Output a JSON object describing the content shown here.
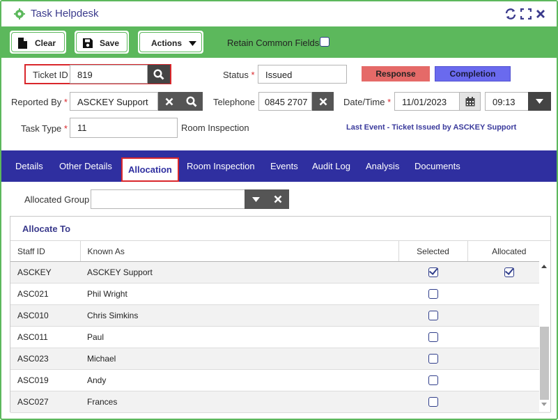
{
  "window": {
    "title": "Task Helpdesk",
    "icons": [
      "refresh-icon",
      "maximize-icon",
      "close-icon"
    ]
  },
  "toolbar": {
    "clear_label": "Clear",
    "save_label": "Save",
    "actions_label": "Actions",
    "retain_label": "Retain Common Fields",
    "retain_checked": false
  },
  "form": {
    "ticket_id_label": "Ticket ID",
    "ticket_id_value": "819",
    "status_label": "Status",
    "status_value": "Issued",
    "response_label": "Response",
    "completion_label": "Completion",
    "reported_by_label": "Reported By",
    "reported_by_value": "ASCKEY Support",
    "telephone_label": "Telephone",
    "telephone_value": "0845 2707",
    "datetime_label": "Date/Time",
    "date_value": "11/01/2023",
    "time_value": "09:13",
    "task_type_label": "Task Type",
    "task_type_value": "11",
    "task_type_desc": "Room Inspection",
    "last_event_text": "Last Event -  Ticket Issued by ASCKEY Support",
    "required_marker": "*"
  },
  "tabs": [
    {
      "label": "Details",
      "active": false
    },
    {
      "label": "Other Details",
      "active": false
    },
    {
      "label": "Allocation",
      "active": true
    },
    {
      "label": "Room Inspection",
      "active": false
    },
    {
      "label": "Events",
      "active": false
    },
    {
      "label": "Audit Log",
      "active": false
    },
    {
      "label": "Analysis",
      "active": false
    },
    {
      "label": "Documents",
      "active": false
    }
  ],
  "allocation": {
    "group_label": "Allocated Group",
    "group_value": "",
    "panel_title": "Allocate To",
    "columns": [
      "Staff ID",
      "Known As",
      "Selected",
      "Allocated"
    ],
    "rows": [
      {
        "staff_id": "ASCKEY",
        "known_as": "ASCKEY Support",
        "selected": true,
        "allocated": true
      },
      {
        "staff_id": "ASC021",
        "known_as": "Phil Wright",
        "selected": false,
        "allocated": false
      },
      {
        "staff_id": "ASC010",
        "known_as": "Chris Simkins",
        "selected": false,
        "allocated": false
      },
      {
        "staff_id": "ASC011",
        "known_as": "Paul",
        "selected": false,
        "allocated": false
      },
      {
        "staff_id": "ASC023",
        "known_as": "Michael",
        "selected": false,
        "allocated": false
      },
      {
        "staff_id": "ASC019",
        "known_as": "Andy",
        "selected": false,
        "allocated": false
      },
      {
        "staff_id": "ASC027",
        "known_as": "Frances",
        "selected": false,
        "allocated": false
      }
    ]
  },
  "colors": {
    "accent_green": "#5cb85c",
    "tab_bar": "#2f2fa0",
    "highlight_red": "#d9262b",
    "response_button": "#e56a68",
    "completion_button": "#6a6aee"
  }
}
